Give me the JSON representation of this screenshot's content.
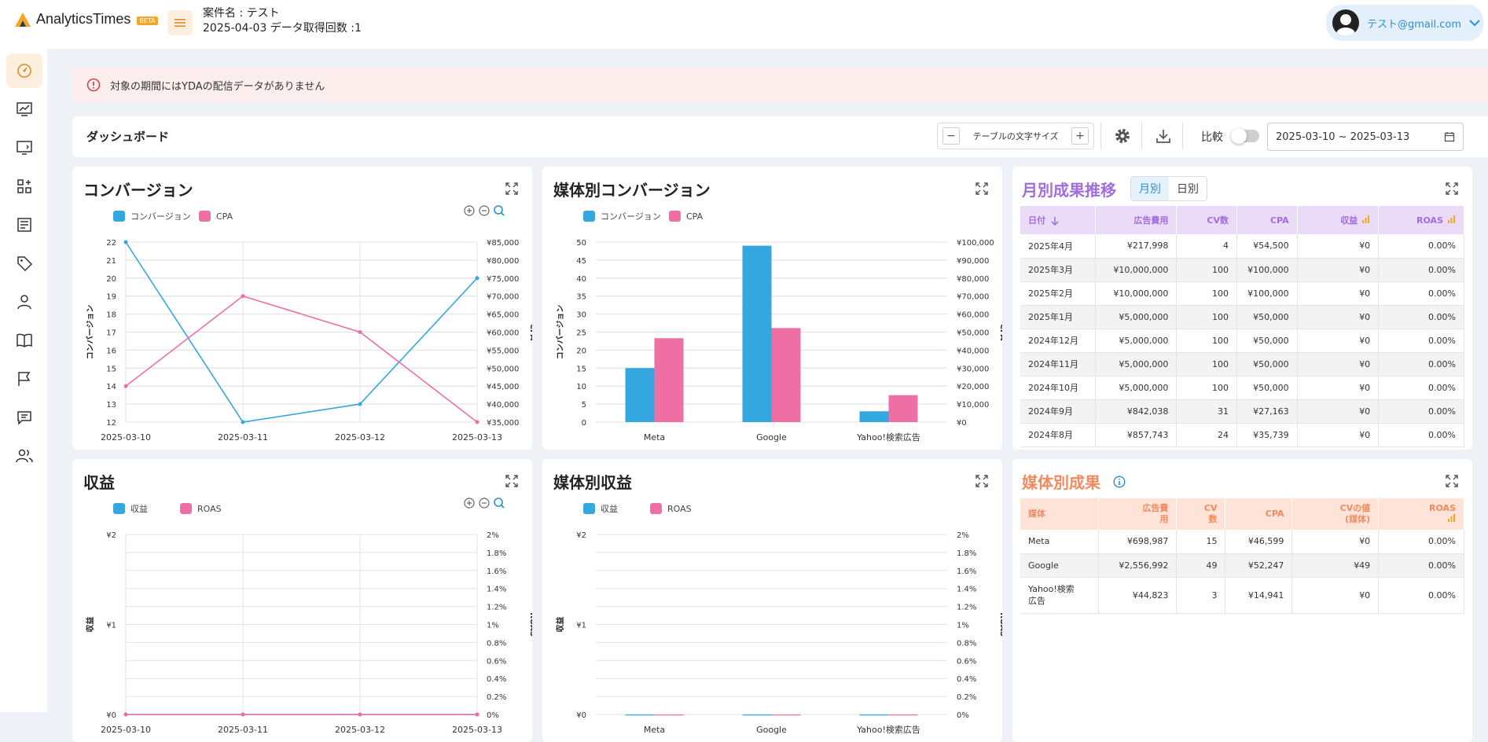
{
  "app": {
    "name": "AnalyticsTimes",
    "badge": "BETA"
  },
  "project": {
    "name_line": "案件名 : テスト",
    "date_line": "2025-04-03 データ取得回数 :1"
  },
  "user": {
    "email": "テスト@gmail.com"
  },
  "sidebar": {
    "icons": [
      "dashboard-icon",
      "chart-icon",
      "monitor-code-icon",
      "apps-add-icon",
      "report-icon",
      "tag-icon",
      "user-icon",
      "book-icon",
      "flag-icon",
      "comment-icon",
      "users-icon"
    ]
  },
  "alert": {
    "text": "対象の期間にはYDAの配信データがありません"
  },
  "toolbar": {
    "title": "ダッシュボード",
    "font_size_label": "テーブルの文字サイズ",
    "minus": "−",
    "plus": "+",
    "compare_label": "比較",
    "date_range": "2025-03-10 ~ 2025-03-13"
  },
  "colors": {
    "blue": "#35a7e0",
    "pink": "#ef6fa5",
    "accent": "#f5a623",
    "purple": "#a06ce0",
    "orange": "#f18a5e"
  },
  "cards": {
    "conversion": {
      "title": "コンバージョン",
      "legend": [
        "コンバージョン",
        "CPA"
      ]
    },
    "media_conversion": {
      "title": "媒体別コンバージョン",
      "legend": [
        "コンバージョン",
        "CPA"
      ]
    },
    "revenue": {
      "title": "収益",
      "legend": [
        "収益",
        "ROAS"
      ]
    },
    "media_revenue": {
      "title": "媒体別収益",
      "legend": [
        "収益",
        "ROAS"
      ]
    }
  },
  "chart_data": [
    {
      "id": "conversion",
      "type": "line",
      "x": [
        "2025-03-10",
        "2025-03-11",
        "2025-03-12",
        "2025-03-13"
      ],
      "series": [
        {
          "name": "コンバージョン",
          "axis": "left",
          "values": [
            22,
            12,
            13,
            20
          ]
        },
        {
          "name": "CPA",
          "axis": "right",
          "values": [
            45000,
            70000,
            60000,
            35000
          ]
        }
      ],
      "ylabel": "コンバージョン",
      "y2label": "CPA",
      "ylim": [
        12,
        22
      ],
      "y2lim": [
        35000,
        85000
      ],
      "yticks": [
        "22",
        "21",
        "20",
        "19",
        "18",
        "17",
        "16",
        "15",
        "14",
        "13",
        "12"
      ],
      "y2ticks": [
        "¥85,000",
        "¥80,000",
        "¥75,000",
        "¥70,000",
        "¥65,000",
        "¥60,000",
        "¥55,000",
        "¥50,000",
        "¥45,000",
        "¥40,000",
        "¥35,000"
      ],
      "grid": true,
      "legend": "top-left"
    },
    {
      "id": "media_conversion",
      "type": "bar",
      "categories": [
        "Meta",
        "Google",
        "Yahoo!検索広告"
      ],
      "series": [
        {
          "name": "コンバージョン",
          "axis": "left",
          "values": [
            15,
            49,
            3
          ]
        },
        {
          "name": "CPA",
          "axis": "right",
          "values": [
            46599,
            52247,
            14941
          ]
        }
      ],
      "ylabel": "コンバージョン",
      "y2label": "CPA",
      "ylim": [
        0,
        50
      ],
      "y2lim": [
        0,
        100000
      ],
      "yticks": [
        "50",
        "45",
        "40",
        "35",
        "30",
        "25",
        "20",
        "15",
        "10",
        "5",
        "0"
      ],
      "y2ticks": [
        "¥100,000",
        "¥90,000",
        "¥80,000",
        "¥70,000",
        "¥60,000",
        "¥50,000",
        "¥40,000",
        "¥30,000",
        "¥20,000",
        "¥10,000",
        "¥0"
      ],
      "grid": true,
      "legend": "top-left"
    },
    {
      "id": "revenue",
      "type": "line",
      "x": [
        "2025-03-10",
        "2025-03-11",
        "2025-03-12",
        "2025-03-13"
      ],
      "series": [
        {
          "name": "収益",
          "axis": "left",
          "values": [
            0,
            0,
            0,
            0
          ]
        },
        {
          "name": "ROAS",
          "axis": "right",
          "values": [
            0,
            0,
            0,
            0
          ]
        }
      ],
      "ylabel": "収益",
      "y2label": "ROAS",
      "ylim": [
        0,
        2
      ],
      "y2lim": [
        0,
        2
      ],
      "yticks": [
        "¥2",
        "¥1",
        "¥0"
      ],
      "y2ticks": [
        "2%",
        "1.8%",
        "1.6%",
        "1.4%",
        "1.2%",
        "1%",
        "0.8%",
        "0.6%",
        "0.4%",
        "0.2%",
        "0%"
      ],
      "grid": true,
      "legend": "top-left"
    },
    {
      "id": "media_revenue",
      "type": "bar",
      "categories": [
        "Meta",
        "Google",
        "Yahoo!検索広告"
      ],
      "series": [
        {
          "name": "収益",
          "axis": "left",
          "values": [
            0,
            0,
            0
          ]
        },
        {
          "name": "ROAS",
          "axis": "right",
          "values": [
            0,
            0,
            0
          ]
        }
      ],
      "ylabel": "収益",
      "y2label": "ROAS",
      "ylim": [
        0,
        2
      ],
      "y2lim": [
        0,
        2
      ],
      "yticks": [
        "¥2",
        "¥1",
        "¥0"
      ],
      "y2ticks": [
        "2%",
        "1.8%",
        "1.6%",
        "1.4%",
        "1.2%",
        "1%",
        "0.8%",
        "0.6%",
        "0.4%",
        "0.2%",
        "0%"
      ],
      "grid": true,
      "legend": "top-left"
    }
  ],
  "monthly": {
    "title": "月別成果推移",
    "tabs": [
      "月別",
      "日別"
    ],
    "headers": [
      "日付",
      "広告費用",
      "CV数",
      "CPA",
      "収益",
      "ROAS"
    ],
    "rows": [
      [
        "2025年4月",
        "¥217,998",
        "4",
        "¥54,500",
        "¥0",
        "0.00%"
      ],
      [
        "2025年3月",
        "¥10,000,000",
        "100",
        "¥100,000",
        "¥0",
        "0.00%"
      ],
      [
        "2025年2月",
        "¥10,000,000",
        "100",
        "¥100,000",
        "¥0",
        "0.00%"
      ],
      [
        "2025年1月",
        "¥5,000,000",
        "100",
        "¥50,000",
        "¥0",
        "0.00%"
      ],
      [
        "2024年12月",
        "¥5,000,000",
        "100",
        "¥50,000",
        "¥0",
        "0.00%"
      ],
      [
        "2024年11月",
        "¥5,000,000",
        "100",
        "¥50,000",
        "¥0",
        "0.00%"
      ],
      [
        "2024年10月",
        "¥5,000,000",
        "100",
        "¥50,000",
        "¥0",
        "0.00%"
      ],
      [
        "2024年9月",
        "¥842,038",
        "31",
        "¥27,163",
        "¥0",
        "0.00%"
      ],
      [
        "2024年8月",
        "¥857,743",
        "24",
        "¥35,739",
        "¥0",
        "0.00%"
      ]
    ]
  },
  "media": {
    "title": "媒体別成果",
    "headers": [
      [
        "媒体"
      ],
      [
        "広告費",
        "用"
      ],
      [
        "CV",
        "数"
      ],
      [
        "CPA"
      ],
      [
        "CVの値",
        "(媒体)"
      ],
      [
        "ROAS"
      ]
    ],
    "rows": [
      [
        [
          "Meta"
        ],
        "¥698,987",
        "15",
        "¥46,599",
        "¥0",
        "0.00%"
      ],
      [
        [
          "Google"
        ],
        "¥2,556,992",
        "49",
        "¥52,247",
        "¥49",
        "0.00%"
      ],
      [
        [
          "Yahoo!検索",
          "広告"
        ],
        "¥44,823",
        "3",
        "¥14,941",
        "¥0",
        "0.00%"
      ]
    ]
  }
}
